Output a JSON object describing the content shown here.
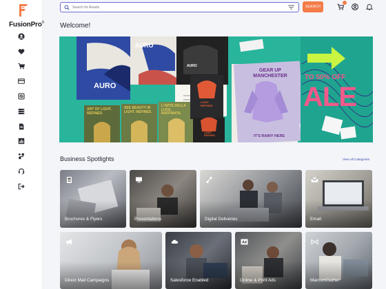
{
  "brand": {
    "name": "FusionPro",
    "trademark": "®",
    "accent": "#f37c48"
  },
  "sidebar": {
    "items": [
      {
        "icon": "user-icon"
      },
      {
        "icon": "heart-icon"
      },
      {
        "icon": "cart-icon"
      },
      {
        "icon": "credit-card-icon"
      },
      {
        "icon": "no-entry-icon"
      },
      {
        "icon": "server-list-icon"
      },
      {
        "icon": "document-icon"
      },
      {
        "icon": "bar-chart-icon"
      },
      {
        "icon": "workflow-icon"
      },
      {
        "icon": "headset-icon"
      },
      {
        "icon": "logout-icon"
      }
    ]
  },
  "search": {
    "placeholder": "Search for Assets",
    "button_label": "SEARCH"
  },
  "header_icons": {
    "cart": "cart-icon",
    "account": "user-circle-icon",
    "notifications": "bell-icon"
  },
  "welcome": {
    "title": "Welcome!"
  },
  "banner": {
    "card_text_1": "AURO",
    "card_text_2": "AURO",
    "card_text_3": "AURO",
    "poster_1": "ART OF LIGHT. REFINED.",
    "poster_2": "SEE BEAUTY IN LIGHT. REFINED.",
    "poster_3": "L'ARTE DELLA LUCE. RAFFINATA.",
    "lamp_card": "LIGHT. REFINED.",
    "lamp_card_2": "LIGHT. REFINED.",
    "headline": "GEAR UP MANCHESTER",
    "subline": "IT'S RAINY HERE",
    "sale_top": "TO 50% OFF",
    "sale_big": "ALE"
  },
  "spotlights": {
    "title": "Business Spotlights",
    "view_all": "View all Categories",
    "tiles": [
      {
        "label": "Brochures & Flyers",
        "icon": "brochure-icon"
      },
      {
        "label": "Presentations",
        "icon": "presentation-icon"
      },
      {
        "label": "Digital Deliveries",
        "icon": "share-icon"
      },
      {
        "label": "Email",
        "icon": "envelope-icon"
      },
      {
        "label": "Direct Mail Campaigns",
        "icon": "megaphone-icon"
      },
      {
        "label": "Salesforce Enabled",
        "icon": "cloud-icon"
      },
      {
        "label": "Online & Print Ads",
        "icon": "ad-icon"
      },
      {
        "label": "MarcomGather",
        "icon": "bowtie-icon"
      }
    ]
  }
}
